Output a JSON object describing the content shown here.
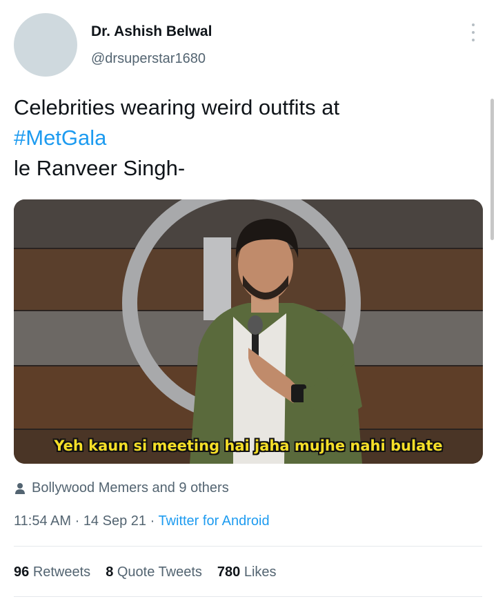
{
  "author": {
    "name": "Dr. Ashish Belwal",
    "handle": "@drsuperstar1680"
  },
  "tweet": {
    "line1": "Celebrities wearing weird outfits at",
    "hashtag": "#MetGala",
    "line3": "le Ranveer Singh-"
  },
  "media": {
    "caption": "Yeh kaun si meeting hai jaha mujhe nahi bulate"
  },
  "liked_by": "Bollywood Memers and 9 others",
  "meta": {
    "time": "11:54 AM",
    "sep1": " · ",
    "date": "14 Sep 21",
    "sep2": " · ",
    "source": "Twitter for Android"
  },
  "stats": {
    "retweets_count": "96",
    "retweets_label": "Retweets",
    "quotes_count": "8",
    "quotes_label": "Quote Tweets",
    "likes_count": "780",
    "likes_label": "Likes"
  },
  "icons": [
    "more-options-icon",
    "person-icon"
  ],
  "colors": {
    "accent": "#1d9bf0",
    "caption": "#f5df28"
  }
}
